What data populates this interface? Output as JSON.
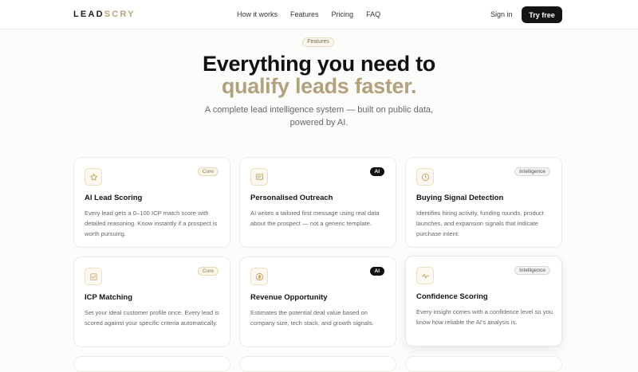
{
  "brand": {
    "part1": "LEAD",
    "part2": "SCRY"
  },
  "nav": {
    "links": [
      "How it works",
      "Features",
      "Pricing",
      "FAQ"
    ],
    "signin": "Sign in",
    "cta": "Try free"
  },
  "hero": {
    "pill": "Features",
    "title_line1": "Everything you need to",
    "title_line2": "qualify leads faster.",
    "subtitle": "A complete lead intelligence system — built on public data, powered by AI."
  },
  "cards": [
    {
      "icon": "star-icon",
      "badge": "Core",
      "title": "AI Lead Scoring",
      "desc": "Every lead gets a 0–100 ICP match score with detailed reasoning. Know instantly if a prospect is worth pursuing."
    },
    {
      "icon": "message-icon",
      "badge": "AI",
      "title": "Personalised Outreach",
      "desc": "AI writes a tailored first message using real data about the prospect — not a generic template."
    },
    {
      "icon": "clock-icon",
      "badge": "Intelligence",
      "title": "Buying Signal Detection",
      "desc": "Identifies hiring activity, funding rounds, product launches, and expansion signals that indicate purchase intent."
    },
    {
      "icon": "check-square-icon",
      "badge": "Core",
      "title": "ICP Matching",
      "desc": "Set your ideal customer profile once. Every lead is scored against your specific criteria automatically."
    },
    {
      "icon": "dollar-circle-icon",
      "badge": "AI",
      "title": "Revenue Opportunity",
      "desc": "Estimates the potential deal value based on company size, tech stack, and growth signals."
    },
    {
      "icon": "pulse-icon",
      "badge": "Intelligence",
      "title": "Confidence Scoring",
      "desc": "Every insight comes with a confidence level so you know how reliable the AI's analysis is."
    }
  ],
  "colors": {
    "accent": "#b3a07c",
    "dark": "#141414",
    "text_muted": "#666666"
  }
}
